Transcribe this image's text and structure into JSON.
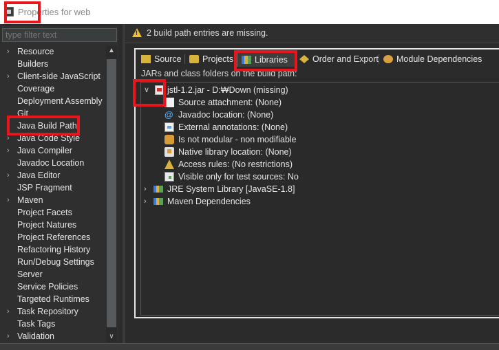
{
  "window": {
    "title": "Properties for web"
  },
  "filter": {
    "placeholder": "type filter text"
  },
  "sidebar": {
    "items": [
      {
        "label": "Resource",
        "expandable": true
      },
      {
        "label": "Builders",
        "expandable": false
      },
      {
        "label": "Client-side JavaScript",
        "expandable": true
      },
      {
        "label": "Coverage",
        "expandable": false
      },
      {
        "label": "Deployment Assembly",
        "expandable": false
      },
      {
        "label": "Git",
        "expandable": false
      },
      {
        "label": "Java Build Path",
        "expandable": false,
        "selected": true
      },
      {
        "label": "Java Code Style",
        "expandable": true
      },
      {
        "label": "Java Compiler",
        "expandable": true
      },
      {
        "label": "Javadoc Location",
        "expandable": false
      },
      {
        "label": "Java Editor",
        "expandable": true
      },
      {
        "label": "JSP Fragment",
        "expandable": false
      },
      {
        "label": "Maven",
        "expandable": true
      },
      {
        "label": "Project Facets",
        "expandable": false
      },
      {
        "label": "Project Natures",
        "expandable": false
      },
      {
        "label": "Project References",
        "expandable": false
      },
      {
        "label": "Refactoring History",
        "expandable": false
      },
      {
        "label": "Run/Debug Settings",
        "expandable": false
      },
      {
        "label": "Server",
        "expandable": false
      },
      {
        "label": "Service Policies",
        "expandable": false
      },
      {
        "label": "Targeted Runtimes",
        "expandable": false
      },
      {
        "label": "Task Repository",
        "expandable": true
      },
      {
        "label": "Task Tags",
        "expandable": false
      },
      {
        "label": "Validation",
        "expandable": true
      }
    ]
  },
  "message": {
    "text": "2 build path entries are missing.",
    "icon": "warning-icon"
  },
  "tabs": [
    {
      "label": "Source",
      "icon": "source-icon"
    },
    {
      "label": "Projects",
      "icon": "projects-icon"
    },
    {
      "label": "Libraries",
      "icon": "libraries-icon",
      "active": true
    },
    {
      "label": "Order and Export",
      "icon": "order-export-icon"
    },
    {
      "label": "Module Dependencies",
      "icon": "module-icon"
    }
  ],
  "libraries": {
    "description": "JARs and class folders on the build path:",
    "jar": {
      "label": "jstl-1.2.jar - D:₩Down (missing)",
      "attributes": [
        "Source attachment: (None)",
        "Javadoc location: (None)",
        "External annotations: (None)",
        "Is not modular - non modifiable",
        "Native library location: (None)",
        "Access rules: (No restrictions)",
        "Visible only for test sources: No"
      ]
    },
    "containers": [
      "JRE System Library [JavaSE-1.8]",
      "Maven Dependencies"
    ]
  },
  "colors": {
    "highlight": "#e8151d",
    "background": "#2b2b2b",
    "text": "#e6e6e6"
  }
}
